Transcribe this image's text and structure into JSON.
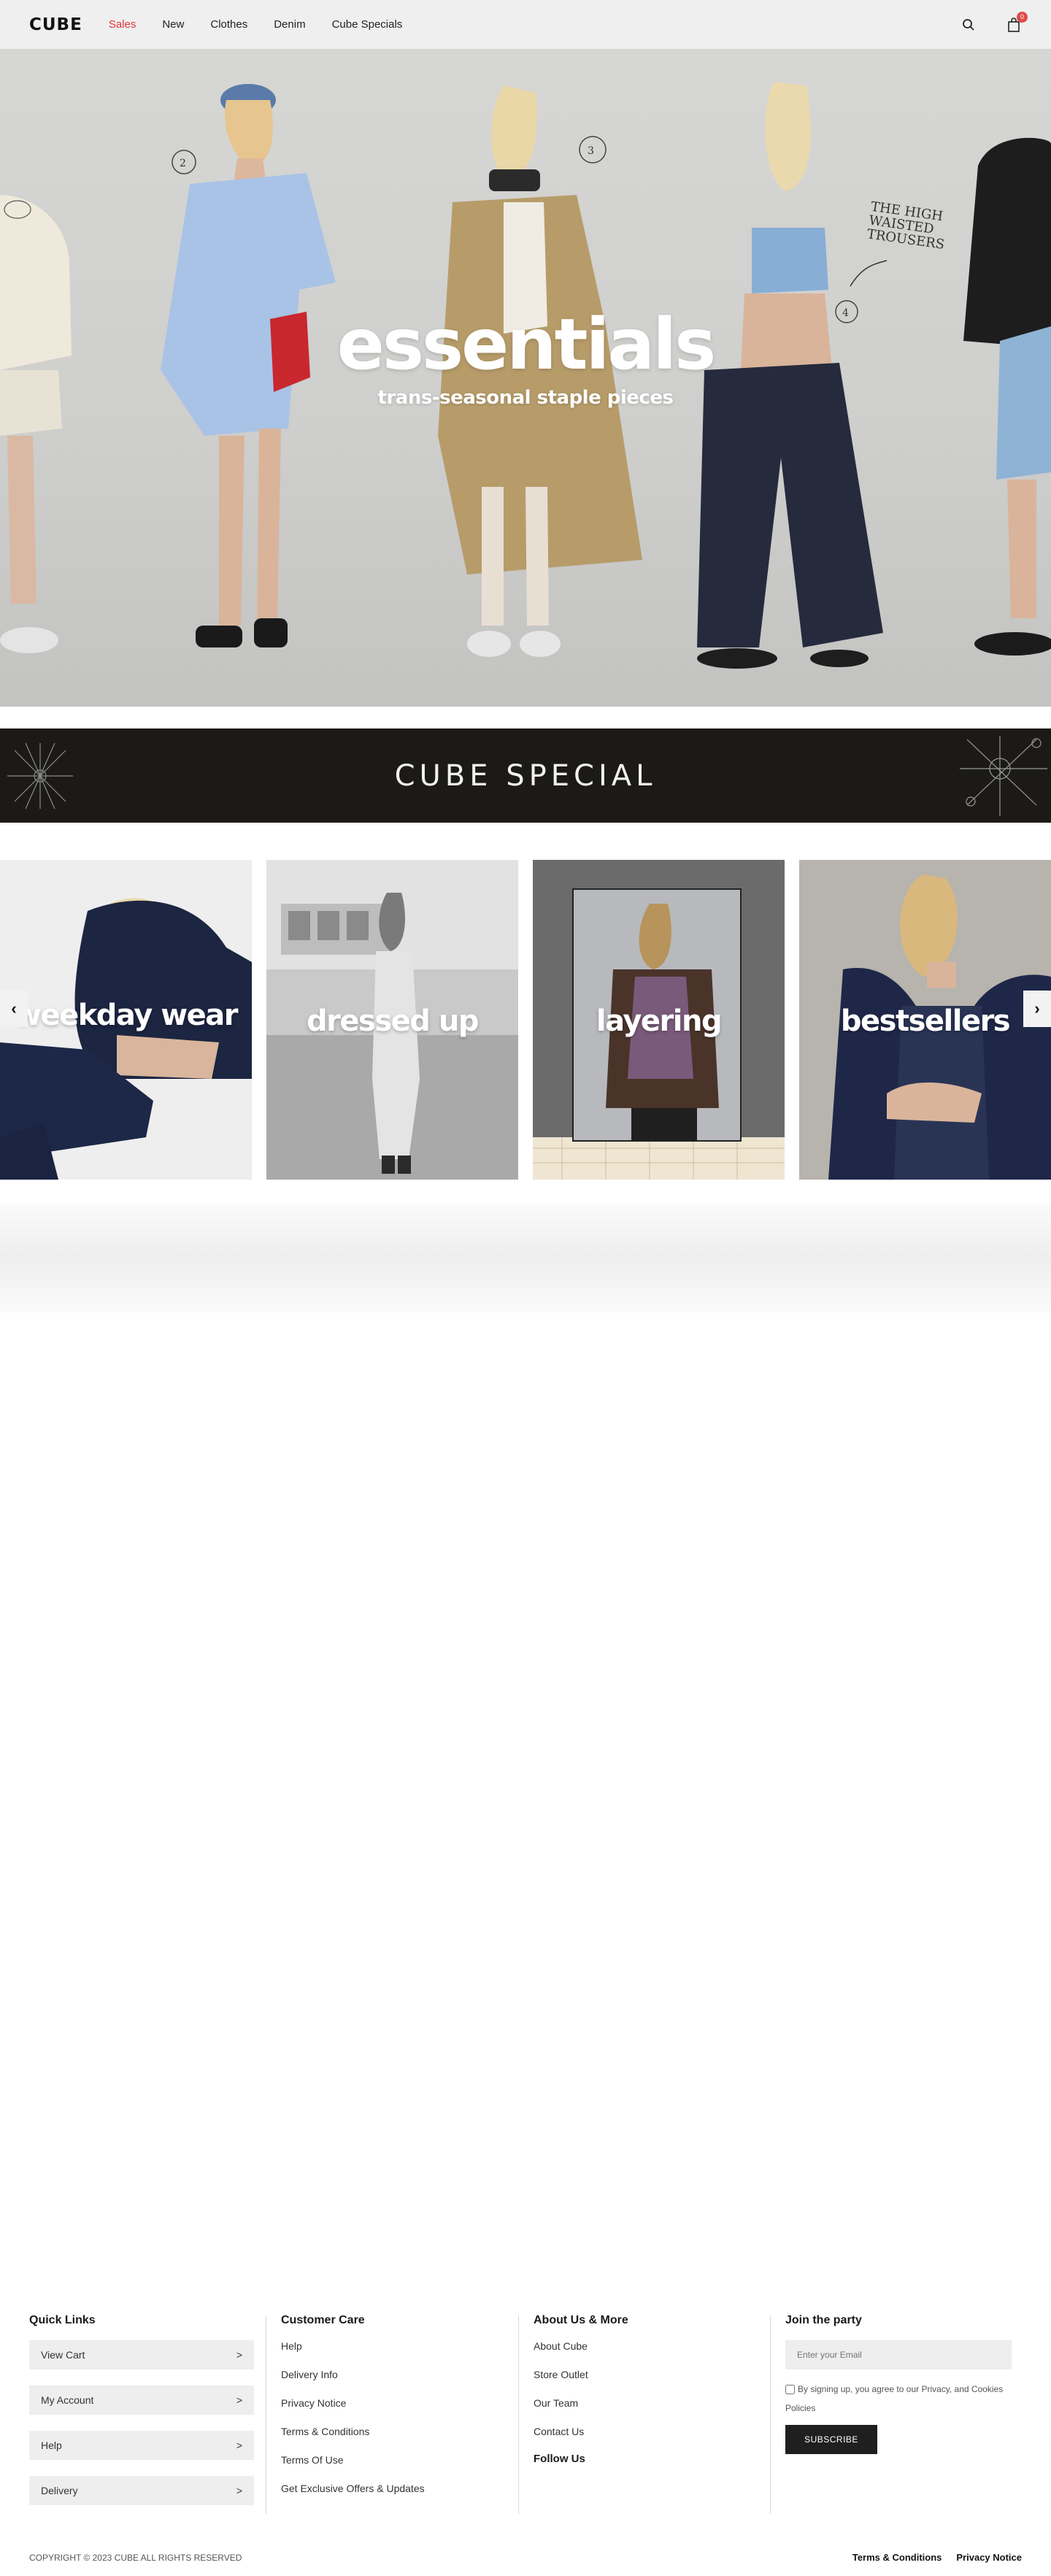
{
  "header": {
    "logo": "CUBE",
    "nav": [
      "Sales",
      "New",
      "Clothes",
      "Denim",
      "Cube Specials"
    ],
    "cart_count": "0"
  },
  "hero": {
    "title": "essentials",
    "subtitle": "trans-seasonal staple pieces",
    "annotation": "THE HIGH WAISTED TROUSERS",
    "markers": [
      "2",
      "3",
      "4"
    ]
  },
  "special_banner": {
    "text": "CUBE SPECIAL"
  },
  "categories": [
    {
      "label": "weekday wear"
    },
    {
      "label": "dressed up"
    },
    {
      "label": "layering"
    },
    {
      "label": "bestsellers"
    }
  ],
  "carousel": {
    "prev_glyph": "‹",
    "next_glyph": "›"
  },
  "footer": {
    "quick_links": {
      "title": "Quick Links",
      "items": [
        "View Cart",
        "My Account",
        "Help",
        "Delivery"
      ]
    },
    "customer_care": {
      "title": "Customer Care",
      "items": [
        "Help",
        "Delivery Info",
        "Privacy Notice",
        "Terms & Conditions",
        "Terms Of Use",
        "Get Exclusive Offers & Updates"
      ]
    },
    "about": {
      "title": "About Us & More",
      "items": [
        "About Cube",
        "Store Outlet",
        "Our Team",
        "Contact Us"
      ],
      "follow": "Follow Us"
    },
    "newsletter": {
      "title": "Join the party",
      "placeholder": "Enter your Email",
      "consent": "By signing up, you agree to our Privacy, and Cookies Policies",
      "button": "SUBSCRIBE"
    },
    "copyright": "COPYRIGHT © 2023 CUBE ALL RIGHTS RESERVED",
    "legal": [
      "Terms & Conditions",
      "Privacy Notice"
    ]
  },
  "colors": {
    "sale": "#d93636",
    "banner_bg": "#1b1a17",
    "badge": "#e14b4b"
  }
}
